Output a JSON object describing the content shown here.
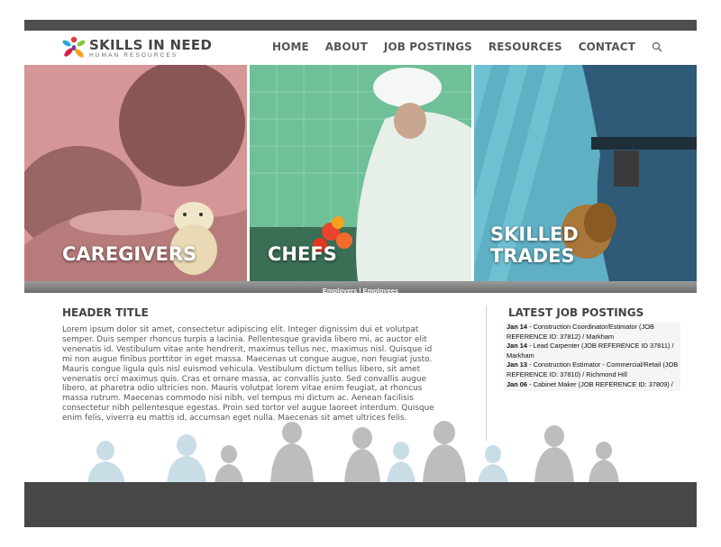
{
  "brand": {
    "name_line1": "SKILLS IN NEED",
    "name_line2": "HUMAN RESOURCES"
  },
  "nav": {
    "items": [
      "HOME",
      "ABOUT",
      "JOB POSTINGS",
      "RESOURCES",
      "CONTACT"
    ],
    "search_icon": "search-icon"
  },
  "panels": [
    {
      "label_line1": "CAREGIVERS",
      "label_line2": "",
      "tint": "#e8a3a3"
    },
    {
      "label_line1": "CHEFS",
      "label_line2": "",
      "tint": "#7fd1a8"
    },
    {
      "label_line1": "SKILLED",
      "label_line2": "TRADES",
      "tint": "#7fd3e0"
    }
  ],
  "strip": {
    "text": "Employers | Employees"
  },
  "main": {
    "title": "HEADER TITLE",
    "body": "Lorem ipsum dolor sit amet, consectetur adipiscing elit. Integer dignissim dui et volutpat semper. Duis semper rhoncus turpis a lacinia. Pellentesque gravida libero mi, ac auctor elit venenatis id. Vestibulum vitae ante hendrerit, maximus tellus nec, maximus nisl. Quisque id mi non augue finibus porttitor in eget massa. Maecenas ut congue augue, non feugiat justo. Mauris congue ligula quis nisl euismod vehicula. Vestibulum dictum tellus libero, sit amet venenatis orci maximus quis. Cras et ornare massa, ac convallis justo. Sed convallis augue libero, at pharetra odio ultricies non. Mauris volutpat lorem vitae enim feugiat, at rhoncus massa rutrum. Maecenas commodo nisi nibh, vel tempus mi dictum ac. Aenean facilisis consectetur nibh pellentesque egestas. Proin sed tortor vel augue laoreet interdum. Quisque enim felis, viverra eu mattis id, accumsan eget nulla. Maecenas sit amet ultrices felis."
  },
  "jobs": {
    "title": "LATEST JOB POSTINGS",
    "items": [
      {
        "date": "Jan 14",
        "text": " - Construction Coordinator/Estimator (JOB REFERENCE ID: 37812) / Markham"
      },
      {
        "date": "Jan 14",
        "text": " - Lead Carpenter (JOB REFERENCE ID 37811) / Markham"
      },
      {
        "date": "Jan 13",
        "text": " - Construction Estimator - Commercial/Retail (JOB REFERENCE ID: 37810) / Richmond Hill"
      },
      {
        "date": "Jan 06",
        "text": " - Cabinet Maker (JOB REFERENCE ID: 37809) /"
      }
    ]
  },
  "colors": {
    "topbar": "#4e4e4e",
    "footer": "#474747",
    "text": "#555555",
    "heading": "#444444"
  }
}
